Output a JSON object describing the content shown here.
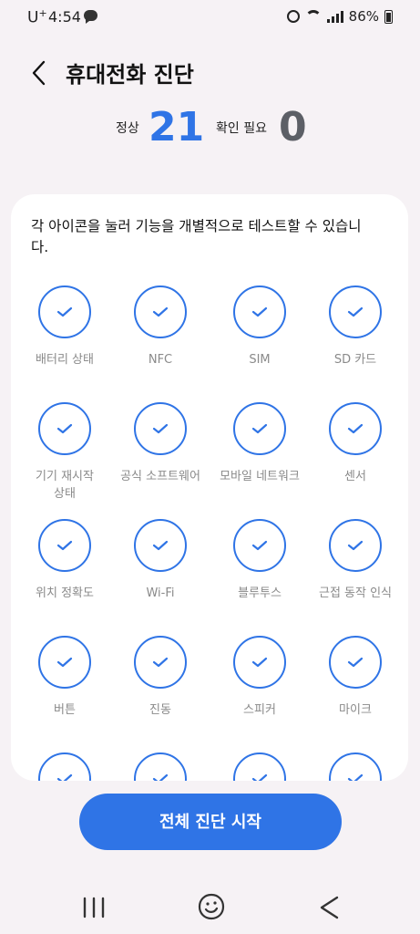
{
  "status_bar": {
    "carrier": "U",
    "carrier_sup": "+",
    "time": "4:54",
    "battery": "86%"
  },
  "header": {
    "title": "휴대전화 진단"
  },
  "summary": {
    "normal_label": "정상",
    "normal_count": "21",
    "check_label": "확인 필요",
    "check_count": "0"
  },
  "card": {
    "instruction": "각 아이콘을 눌러 기능을 개별적으로 테스트할 수 있습니다.",
    "items": [
      {
        "label": "배터리 상태"
      },
      {
        "label": "NFC"
      },
      {
        "label": "SIM"
      },
      {
        "label": "SD 카드"
      },
      {
        "label": "기기 재시작 상태"
      },
      {
        "label": "공식 소프트웨어"
      },
      {
        "label": "모바일 네트워크"
      },
      {
        "label": "센서"
      },
      {
        "label": "위치 정확도"
      },
      {
        "label": "Wi-Fi"
      },
      {
        "label": "블루투스"
      },
      {
        "label": "근접 동작 인식"
      },
      {
        "label": "버튼"
      },
      {
        "label": "진동"
      },
      {
        "label": "스피커"
      },
      {
        "label": "마이크"
      }
    ]
  },
  "actions": {
    "start_label": "전체 진단 시작"
  },
  "colors": {
    "accent": "#2f74e6",
    "muted_count": "#5c5f66",
    "background": "#f6f2f5"
  }
}
